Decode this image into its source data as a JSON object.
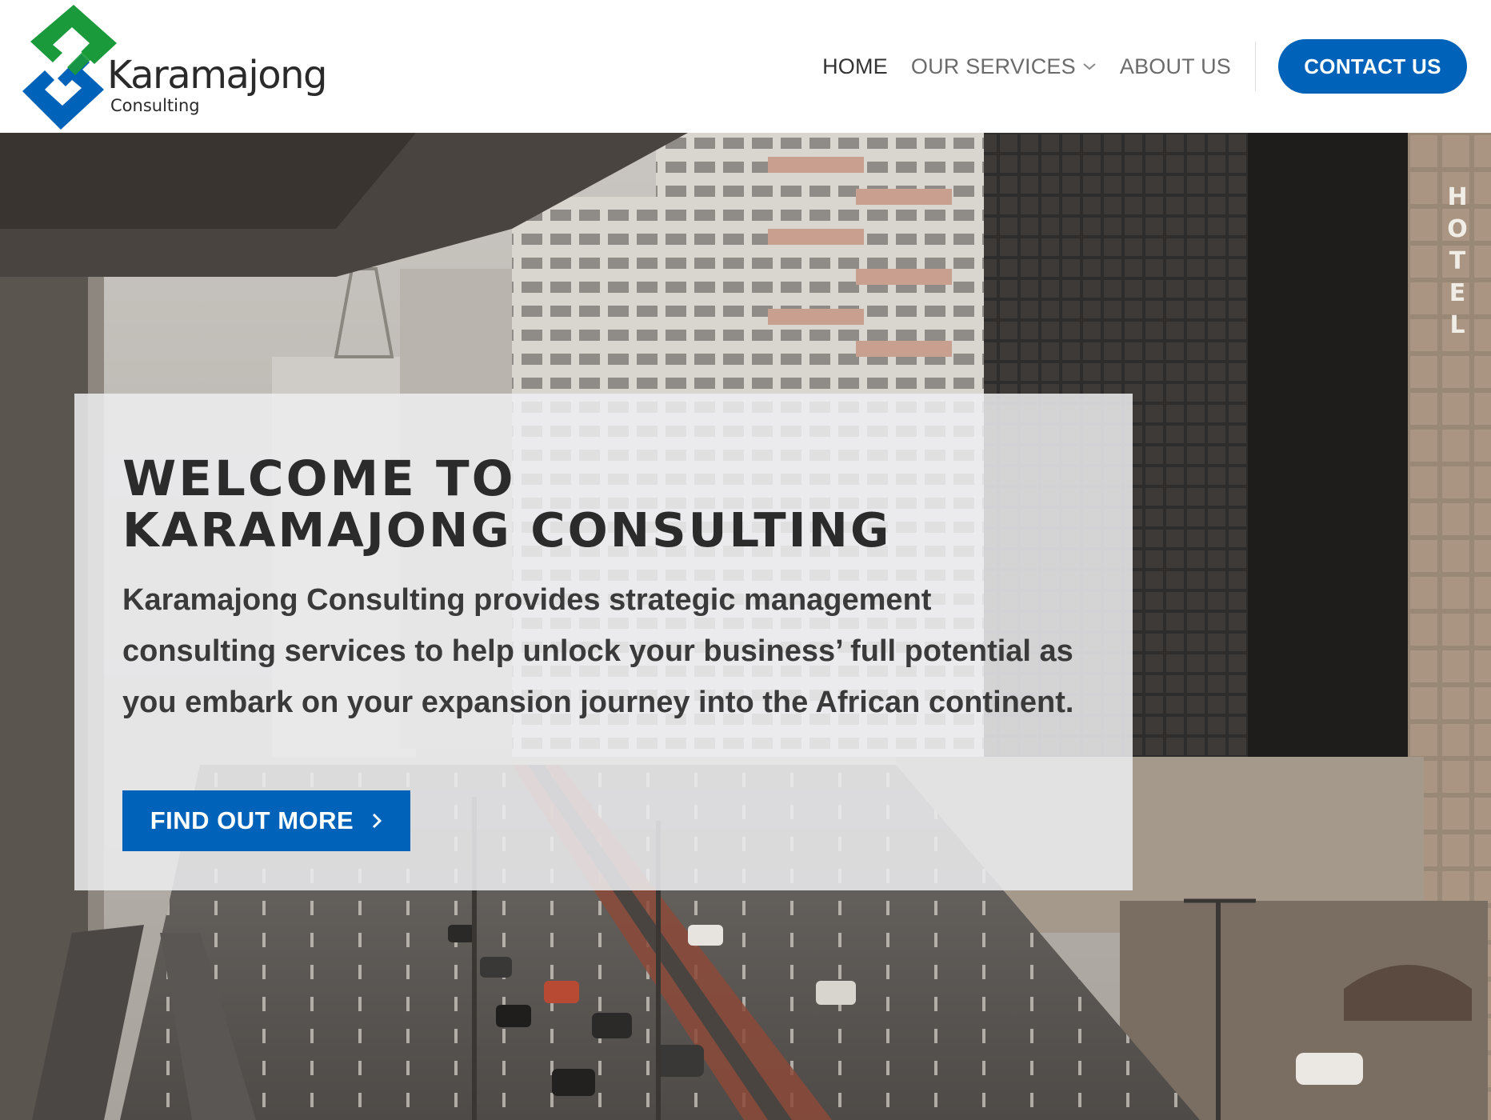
{
  "brand": {
    "name": "Karamajong",
    "tagline": "Consulting",
    "colors": {
      "green": "#1a9a3a",
      "blue": "#0062b8"
    }
  },
  "nav": {
    "items": [
      {
        "label": "HOME",
        "active": true
      },
      {
        "label": "OUR SERVICES",
        "has_dropdown": true
      },
      {
        "label": "ABOUT US"
      }
    ],
    "contact_label": "CONTACT US"
  },
  "hero": {
    "welcome": "WELCOME TO",
    "title": "KARAMAJONG CONSULTING",
    "intro": "Karamajong Consulting provides strategic management consulting services to help unlock your business’ full potential as you embark on your expansion journey into the African continent.",
    "cta_label": "FIND OUT MORE",
    "cta_icon": "chevron-right-icon",
    "background": "city street with high-rise buildings and traffic",
    "building_sign": "HOTEL"
  }
}
